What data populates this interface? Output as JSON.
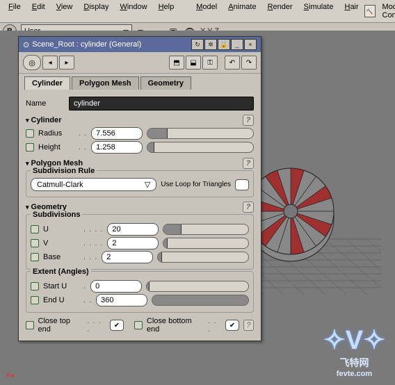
{
  "menubar": [
    "File",
    "Edit",
    "View",
    "Display",
    "Window",
    "Help",
    "Model",
    "Animate",
    "Render",
    "Simulate",
    "Hair"
  ],
  "menuExtra": "Modeling Cons",
  "toolbar": {
    "mode": "B",
    "scope": "User",
    "axes": "X Y Z"
  },
  "panel": {
    "title": "Scene_Root : cylinder (General)",
    "tabs": [
      "Cylinder",
      "Polygon Mesh",
      "Geometry"
    ],
    "activeTab": 0,
    "nameLabel": "Name",
    "nameValue": "cylinder",
    "sections": {
      "cylinder": {
        "title": "Cylinder",
        "radiusLabel": "Radius",
        "radius": "7.556",
        "heightLabel": "Height",
        "height": "1.258"
      },
      "polymesh": {
        "title": "Polygon Mesh",
        "subrule": "Subdivision Rule",
        "subruleVal": "Catmull-Clark",
        "loopLabel": "Use Loop for Triangles"
      },
      "geometry": {
        "title": "Geometry",
        "subdiv": {
          "title": "Subdivisions",
          "u": "U",
          "uVal": "20",
          "v": "V",
          "vVal": "2",
          "base": "Base",
          "baseVal": "2"
        },
        "extent": {
          "title": "Extent (Angles)",
          "startU": "Start U",
          "startVal": "0",
          "endU": "End U",
          "endVal": "360"
        },
        "closeTop": "Close top end",
        "closeBottom": "Close bottom end"
      }
    }
  },
  "logo": {
    "main": "V",
    "sub": "飞特网",
    "url": "fevte.com"
  },
  "chart_data": {
    "type": "other",
    "object": "cylinder",
    "radius": 7.556,
    "height": 1.258,
    "segments": 20,
    "colored_segments": [
      0,
      3,
      6,
      9,
      12,
      15,
      18
    ],
    "color": "#a03030"
  }
}
